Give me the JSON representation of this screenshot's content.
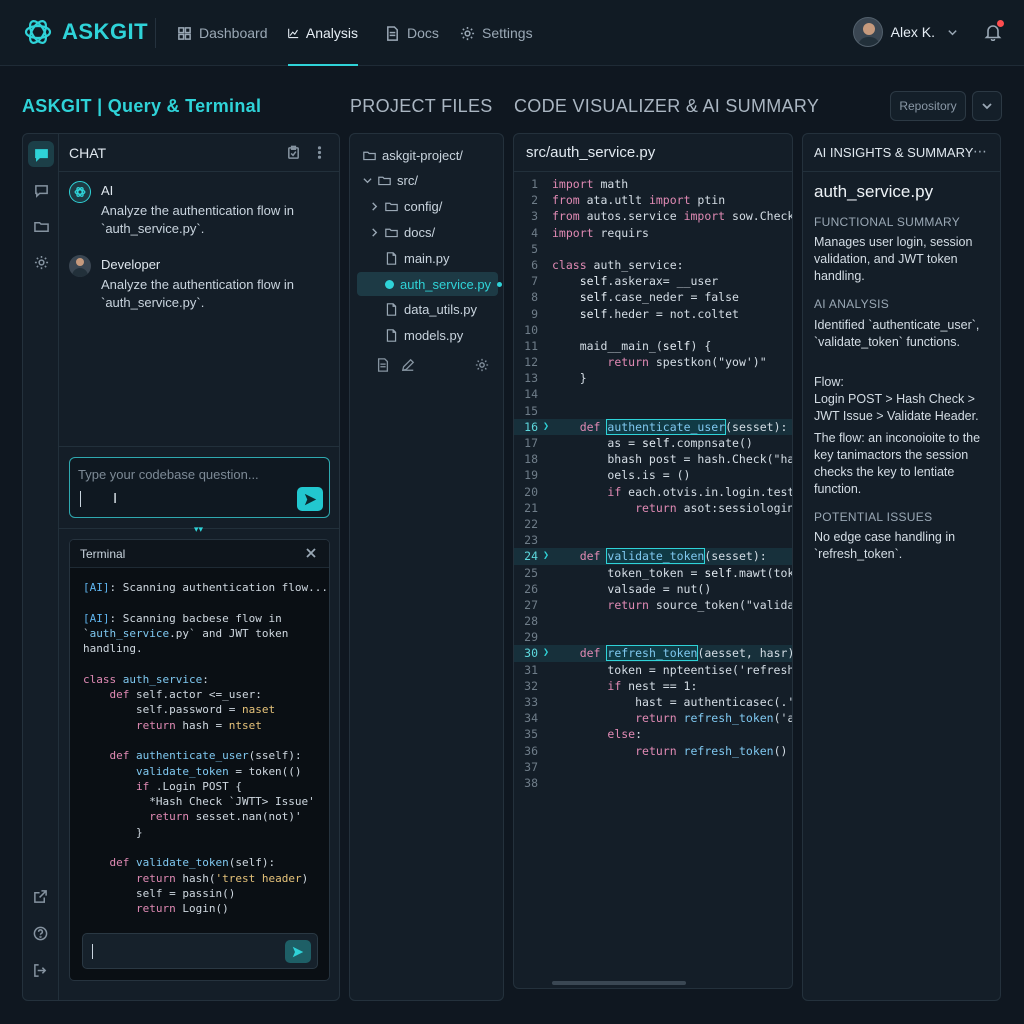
{
  "app": {
    "name": "ASKGIT",
    "accent": "#2fd3d8"
  },
  "nav": {
    "items": [
      {
        "label": "Dashboard",
        "icon": "grid-icon"
      },
      {
        "label": "Analysis",
        "icon": "chart-line-icon",
        "active": true
      },
      {
        "label": "Docs",
        "icon": "document-icon"
      },
      {
        "label": "Settings",
        "icon": "gear-icon"
      }
    ],
    "user_name": "Alex K."
  },
  "sections": {
    "chat": "ASKGIT | Query & Terminal",
    "files": "PROJECT FILES",
    "code": "CODE VISUALIZER & AI SUMMARY",
    "repo_button": "Repository"
  },
  "chat": {
    "title": "CHAT",
    "messages": [
      {
        "sender": "AI",
        "text": "Analyze the authentication flow in `auth_service.py`."
      },
      {
        "sender": "Developer",
        "text": "Analyze the authentication flow in `auth_service.py`."
      }
    ],
    "input_placeholder": "Type your codebase question..."
  },
  "terminal": {
    "title": "Terminal",
    "lines": [
      "[AI]: Scanning authentication flow...",
      "",
      "[AI]: Scanning bacbese flow in",
      "`auth_service.py` and JWT token",
      "handling.",
      "",
      "class auth_service:",
      "    def self.actor <=_user:",
      "        self.password = naset",
      "        return hash = ntset",
      "",
      "    def authenticate_user(sself):",
      "        validate_token = token(()",
      "        if .Login POST {",
      "          *Hash Check `JWTT> Issue'",
      "          return sesset.nan(not)'",
      "        }",
      "",
      "    def validate_token(self):",
      "        return hash('trest header)",
      "        self = passin()",
      "        return Login()"
    ]
  },
  "files": {
    "tree": [
      {
        "label": "askgit-project/",
        "type": "folder",
        "depth": 0,
        "chevron": false
      },
      {
        "label": "src/",
        "type": "folder",
        "depth": 1,
        "chevron": "down"
      },
      {
        "label": "config/",
        "type": "folder",
        "depth": 2,
        "chevron": "right"
      },
      {
        "label": "docs/",
        "type": "folder",
        "depth": 2,
        "chevron": "right"
      },
      {
        "label": "main.py",
        "type": "file",
        "depth": 2
      },
      {
        "label": "auth_service.py",
        "type": "file",
        "depth": 2,
        "active": true
      },
      {
        "label": "data_utils.py",
        "type": "file",
        "depth": 2
      },
      {
        "label": "models.py",
        "type": "file",
        "depth": 2
      }
    ]
  },
  "code": {
    "file": "src/auth_service.py",
    "lines": [
      "import math",
      "from ata.utlt import ptin",
      "from autos.service import sow.CheckAdd",
      "import requirs",
      "",
      "class auth_service:",
      "    self.askerax= __user",
      "    self.case_neder = false",
      "    self.heder = not.coltet",
      "",
      "    maid__main_(self) {",
      "        return spestkon(\"yow')\"",
      "    }",
      "",
      "",
      "    def authenticate_user(sesset):",
      "        as = self.compnsate()",
      "        bhash post = hash.Check(\"hash",
      "        oels.is = ()",
      "        if each.otvis.in.login.testsne",
      "            return asot:sessiologin()",
      "",
      "",
      "    def validate_token(sesset):",
      "        token_token = self.mawt(token_",
      "        valsade = nut()",
      "        return source_token(\"validate_",
      "",
      "",
      "    def refresh_token(aesset, hasr):",
      "        token = npteentise('refreshn_h",
      "        if nest == 1:",
      "            hast = authenticasec(.'use",
      "            return refresh_token('ai_r",
      "        else:",
      "            return refresh_token()",
      "",
      ""
    ],
    "highlighted_lines": [
      16,
      24,
      30
    ]
  },
  "insights": {
    "title": "AI INSIGHTS & SUMMARY",
    "file": "auth_service.py",
    "functional_label": "FUNCTIONAL SUMMARY",
    "functional_text": "Manages user login, session validation, and JWT token handling.",
    "analysis_label": "AI ANALYSIS",
    "analysis_text": "Identified `authenticate_user`, `validate_token` functions.",
    "flow_text": "Flow:\nLogin POST > Hash Check > JWT Issue > Validate Header.",
    "flow_detail": "The flow: an inconoioite to the key tanimactors the session checks the key to lentiate function.",
    "issues_label": "POTENTIAL ISSUES",
    "issues_text": "No edge case handling in `refresh_token`."
  }
}
